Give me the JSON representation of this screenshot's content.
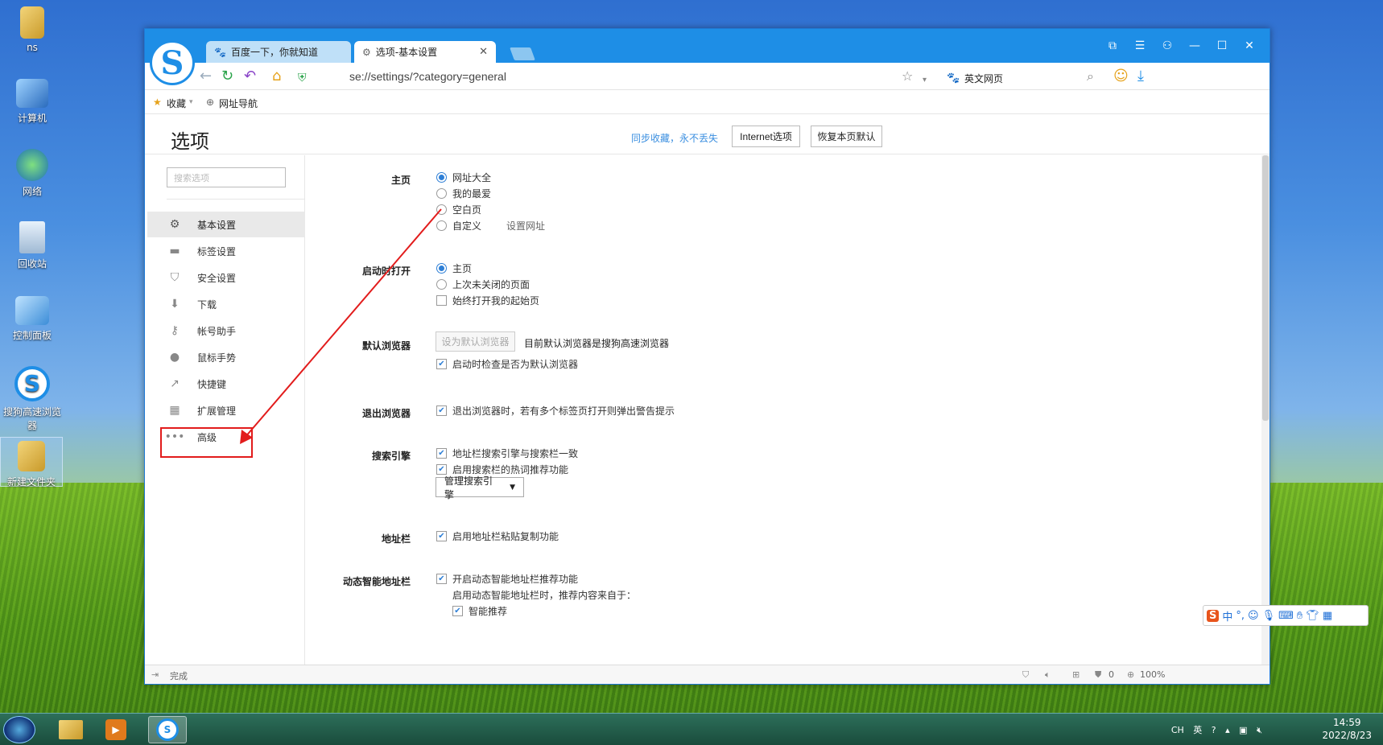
{
  "desktop": {
    "icons": [
      {
        "label": "ns"
      },
      {
        "label": "计算机"
      },
      {
        "label": "网络"
      },
      {
        "label": "回收站"
      },
      {
        "label": "控制面板"
      },
      {
        "label": "搜狗高速浏览器"
      },
      {
        "label": "新建文件夹"
      }
    ]
  },
  "browser": {
    "tabs": [
      {
        "label": "百度一下，你就知道"
      },
      {
        "label": "选项-基本设置"
      }
    ],
    "url": "se://settings/?category=general",
    "search_engine_label": "英文网页",
    "bookmarks": [
      {
        "label": "收藏"
      },
      {
        "label": "网址导航"
      }
    ],
    "status_text": "完成",
    "zoom": "100%",
    "blocked_count": "0"
  },
  "settings": {
    "title": "选项",
    "sync_link": "同步收藏，永不丢失",
    "internet_options": "Internet选项",
    "restore_default": "恢复本页默认",
    "search_placeholder": "搜索选项",
    "sidebar": [
      {
        "label": "基本设置",
        "active": true
      },
      {
        "label": "标签设置"
      },
      {
        "label": "安全设置"
      },
      {
        "label": "下载"
      },
      {
        "label": "帐号助手"
      },
      {
        "label": "鼠标手势"
      },
      {
        "label": "快捷键"
      },
      {
        "label": "扩展管理"
      },
      {
        "label": "高级"
      }
    ],
    "homepage": {
      "label": "主页",
      "options": [
        "网址大全",
        "我的最爱",
        "空白页",
        "自定义"
      ],
      "selected": "网址大全",
      "set_url": "设置网址"
    },
    "startup": {
      "label": "启动时打开",
      "options": [
        "主页",
        "上次未关闭的页面"
      ],
      "selected": "主页",
      "always_start": "始终打开我的起始页"
    },
    "default_browser": {
      "label": "默认浏览器",
      "button": "设为默认浏览器",
      "status": "目前默认浏览器是搜狗高速浏览器",
      "check_on_start": "启动时检查是否为默认浏览器"
    },
    "exit_browser": {
      "label": "退出浏览器",
      "warn": "退出浏览器时，若有多个标签页打开则弹出警告提示"
    },
    "search_engine": {
      "label": "搜索引擎",
      "sync": "地址栏搜索引擎与搜索栏一致",
      "hot_words": "启用搜索栏的热词推荐功能",
      "manage": "管理搜索引擎"
    },
    "address_bar": {
      "label": "地址栏",
      "paste_copy": "启用地址栏粘贴复制功能"
    },
    "smart_bar": {
      "label": "动态智能地址栏",
      "enable": "开启动态智能地址栏推荐功能",
      "source": "启用动态智能地址栏时，推荐内容来自于：",
      "smart": "智能推荐"
    }
  },
  "ime": {
    "label": "中"
  },
  "taskbar": {
    "lang": "CH",
    "ime_mode": "英",
    "time": "14:59",
    "date": "2022/8/23"
  },
  "colors": {
    "accent": "#1e8ee6",
    "annotation": "#e21c1c"
  }
}
